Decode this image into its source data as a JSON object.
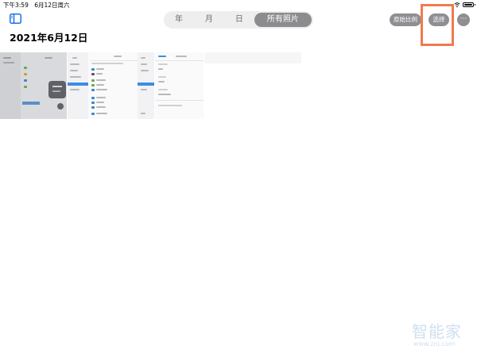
{
  "status_bar": {
    "time": "下午3:59",
    "date": "6月12日周六",
    "battery_level": 0.8
  },
  "toolbar": {
    "sidebar_icon": "sidebar-icon",
    "segments": [
      "年",
      "月",
      "日",
      "所有照片"
    ],
    "active_segment": "所有照片",
    "aspect_label": "原始比例",
    "select_label": "选择",
    "more_label": "···",
    "highlight_color": "#f07a4e"
  },
  "main": {
    "title": "2021年6月12日",
    "thumbnails": [
      {
        "description": "settings screen screenshot with popup"
      },
      {
        "description": "settings list screenshot"
      },
      {
        "description": "settings detail screenshot"
      }
    ]
  },
  "watermark": {
    "text": "智能家",
    "url": "www.znj.com"
  }
}
